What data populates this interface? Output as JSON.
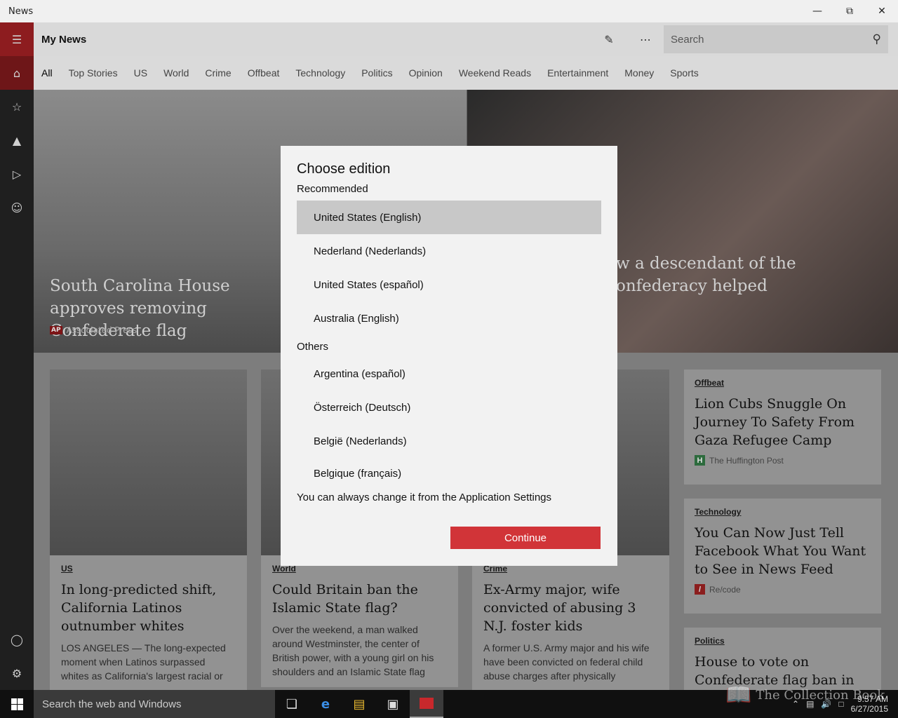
{
  "window": {
    "title": "News"
  },
  "header": {
    "title": "My News",
    "search_placeholder": "Search"
  },
  "tabs": [
    "All",
    "Top Stories",
    "US",
    "World",
    "Crime",
    "Offbeat",
    "Technology",
    "Politics",
    "Opinion",
    "Weekend Reads",
    "Entertainment",
    "Money",
    "Sports"
  ],
  "hero": {
    "left_caption": "South Carolina House approves removing Confederate flag",
    "left_source": "Associated Press",
    "left_source_logo": "AP",
    "right_caption": "w a descendant of the onfederacy helped"
  },
  "cards": [
    {
      "category": "US",
      "headline": "In long-predicted shift, California Latinos outnumber whites",
      "summary": "LOS ANGELES — The long-expected moment when Latinos surpassed whites as California's largest racial or"
    },
    {
      "category": "World",
      "headline": "Could Britain ban the Islamic State flag?",
      "summary": "Over the weekend, a man walked around Westminster, the center of British power, with a young girl on his shoulders and an Islamic State flag"
    },
    {
      "category": "Crime",
      "headline": "Ex-Army major, wife convicted of abusing 3 N.J. foster kids",
      "summary": "A former U.S. Army major and his wife have been convicted on federal child abuse charges after physically"
    }
  ],
  "side_cards": [
    {
      "category": "Offbeat",
      "headline": "Lion Cubs Snuggle On Journey To Safety From Gaza Refugee Camp",
      "source": "The Huffington Post",
      "logo": "H"
    },
    {
      "category": "Technology",
      "headline": "You Can Now Just Tell Facebook What You Want to See in News Feed",
      "source": "Re/code",
      "logo": "/"
    },
    {
      "category": "Politics",
      "headline": "House to vote on Confederate flag ban in"
    }
  ],
  "dialog": {
    "title": "Choose edition",
    "recommended_label": "Recommended",
    "recommended": [
      "United States (English)",
      "Nederland (Nederlands)",
      "United States (español)",
      "Australia (English)"
    ],
    "others_label": "Others",
    "others": [
      "Argentina (español)",
      "Österreich (Deutsch)",
      "België (Nederlands)",
      "Belgique (français)"
    ],
    "note": "You can always change it from the Application Settings",
    "continue_label": "Continue"
  },
  "taskbar": {
    "search_text": "Search the web and Windows",
    "time": "9:57 AM",
    "date": "6/27/2015"
  },
  "watermark": "The Collection Book",
  "colors": {
    "accent": "#d13438",
    "sidebar_active": "#8d1c1f"
  }
}
